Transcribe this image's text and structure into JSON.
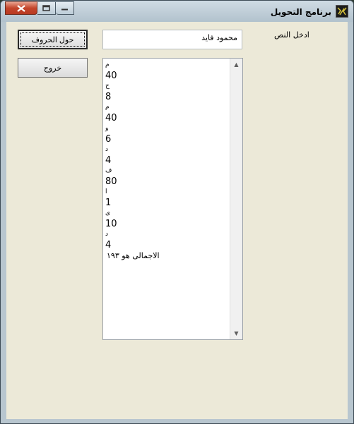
{
  "window": {
    "title": "برنامج التحويل"
  },
  "form": {
    "input_label": "ادخل النص",
    "input_value": "محمود فايد",
    "convert_button": "حول الحروف",
    "exit_button": "خروج"
  },
  "output": {
    "lines": [
      {
        "text": "م",
        "kind": "ar"
      },
      {
        "text": "40",
        "kind": "num"
      },
      {
        "text": "ح",
        "kind": "ar"
      },
      {
        "text": "8",
        "kind": "num"
      },
      {
        "text": "م",
        "kind": "ar"
      },
      {
        "text": "40",
        "kind": "num"
      },
      {
        "text": "و",
        "kind": "ar"
      },
      {
        "text": "6",
        "kind": "num"
      },
      {
        "text": "د",
        "kind": "ar"
      },
      {
        "text": "4",
        "kind": "num"
      },
      {
        "text": "ف",
        "kind": "ar"
      },
      {
        "text": "80",
        "kind": "num"
      },
      {
        "text": "ا",
        "kind": "ar"
      },
      {
        "text": "1",
        "kind": "num"
      },
      {
        "text": "ى",
        "kind": "ar"
      },
      {
        "text": "10",
        "kind": "num"
      },
      {
        "text": "د",
        "kind": "ar"
      },
      {
        "text": "4",
        "kind": "num"
      },
      {
        "text": "الاجمالى هو ١٩٣",
        "kind": "total"
      }
    ]
  }
}
